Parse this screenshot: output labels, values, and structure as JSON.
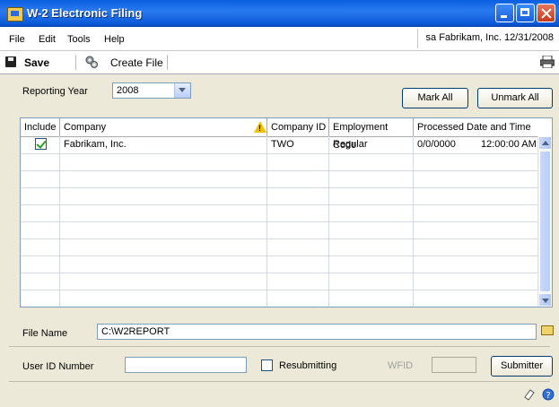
{
  "window": {
    "title": "W-2 Electronic Filing"
  },
  "menu": {
    "items": [
      "File",
      "Edit",
      "Tools",
      "Help"
    ],
    "context": "sa  Fabrikam, Inc.  12/31/2008"
  },
  "toolbar": {
    "save_label": "Save",
    "create_file_label": "Create File"
  },
  "form": {
    "reporting_year_label": "Reporting Year",
    "reporting_year_value": "2008",
    "mark_all_label": "Mark All",
    "unmark_all_label": "Unmark All",
    "file_name_label": "File Name",
    "file_name_value": "C:\\W2REPORT",
    "user_id_label": "User ID Number",
    "user_id_value": "",
    "resubmitting_label": "Resubmitting",
    "wfid_label": "WFID",
    "wfid_value": "",
    "submitter_label": "Submitter"
  },
  "grid": {
    "columns": [
      "Include",
      "Company",
      "Company ID",
      "Employment Code",
      "Processed Date and Time"
    ],
    "rows": [
      {
        "include": true,
        "company": "Fabrikam, Inc.",
        "company_id": "TWO",
        "employment_code": "Regular",
        "processed_date": "0/0/0000",
        "processed_time": "12:00:00 AM"
      }
    ]
  }
}
